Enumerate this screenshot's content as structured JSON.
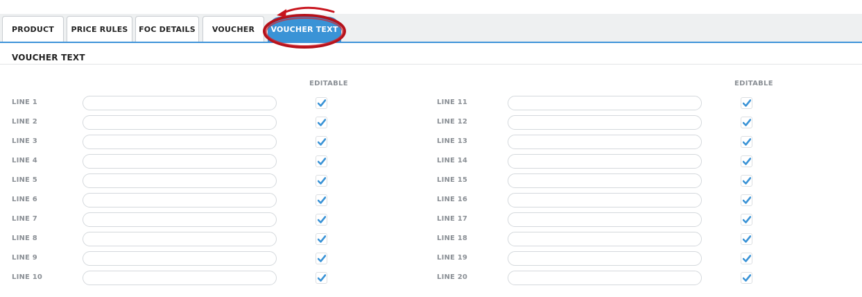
{
  "tabs": [
    {
      "label": "PRODUCT",
      "active": false
    },
    {
      "label": "PRICE RULES",
      "active": false
    },
    {
      "label": "FOC DETAILS",
      "active": false
    },
    {
      "label": "VOUCHER",
      "active": false
    },
    {
      "label": "VOUCHER TEXT",
      "active": true
    }
  ],
  "section": {
    "title": "VOUCHER TEXT"
  },
  "columns": [
    {
      "editable_header": "EDITABLE",
      "lines": [
        {
          "label": "LINE 1",
          "value": "",
          "editable": true
        },
        {
          "label": "LINE 2",
          "value": "",
          "editable": true
        },
        {
          "label": "LINE 3",
          "value": "",
          "editable": true
        },
        {
          "label": "LINE 4",
          "value": "",
          "editable": true
        },
        {
          "label": "LINE 5",
          "value": "",
          "editable": true
        },
        {
          "label": "LINE 6",
          "value": "",
          "editable": true
        },
        {
          "label": "LINE 7",
          "value": "",
          "editable": true
        },
        {
          "label": "LINE 8",
          "value": "",
          "editable": true
        },
        {
          "label": "LINE 9",
          "value": "",
          "editable": true
        },
        {
          "label": "LINE 10",
          "value": "",
          "editable": true
        }
      ]
    },
    {
      "editable_header": "EDITABLE",
      "lines": [
        {
          "label": "LINE 11",
          "value": "",
          "editable": true
        },
        {
          "label": "LINE 12",
          "value": "",
          "editable": true
        },
        {
          "label": "LINE 13",
          "value": "",
          "editable": true
        },
        {
          "label": "LINE 14",
          "value": "",
          "editable": true
        },
        {
          "label": "LINE 15",
          "value": "",
          "editable": true
        },
        {
          "label": "LINE 16",
          "value": "",
          "editable": true
        },
        {
          "label": "LINE 17",
          "value": "",
          "editable": true
        },
        {
          "label": "LINE 18",
          "value": "",
          "editable": true
        },
        {
          "label": "LINE 19",
          "value": "",
          "editable": true
        },
        {
          "label": "LINE 20",
          "value": "",
          "editable": true
        }
      ]
    }
  ],
  "colors": {
    "accent": "#3a93d6",
    "check": "#3a93d6",
    "annotation": "#b5121b"
  }
}
